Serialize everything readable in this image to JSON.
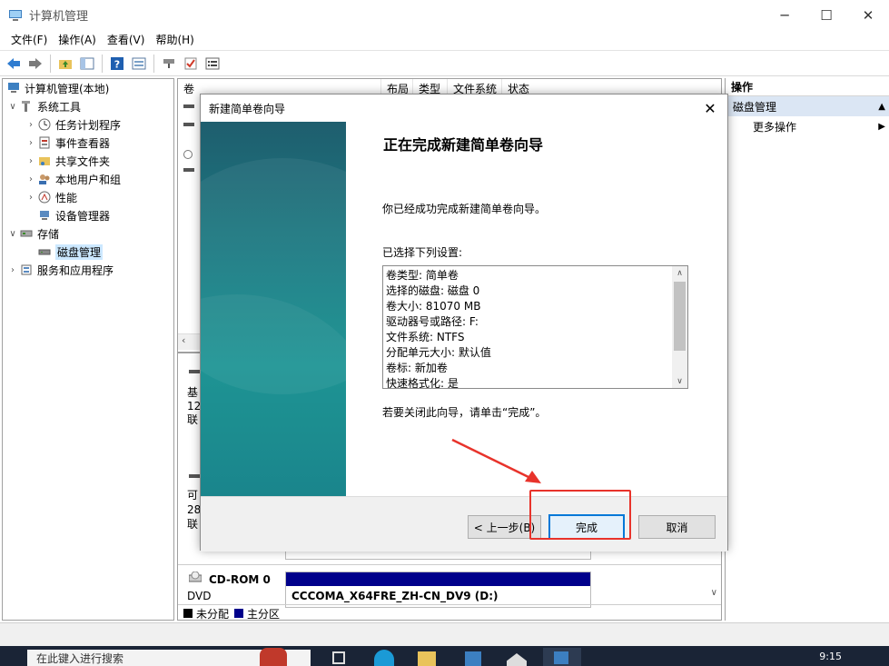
{
  "window": {
    "title": "计算机管理"
  },
  "menu": [
    "文件(F)",
    "操作(A)",
    "查看(V)",
    "帮助(H)"
  ],
  "tree": {
    "root": "计算机管理(本地)",
    "system_tools": "系统工具",
    "task_scheduler": "任务计划程序",
    "event_viewer": "事件查看器",
    "shared_folders": "共享文件夹",
    "local_users": "本地用户和组",
    "performance": "性能",
    "device_manager": "设备管理器",
    "storage": "存储",
    "disk_management": "磁盘管理",
    "services": "服务和应用程序"
  },
  "volume_columns": [
    "卷",
    "布局",
    "类型",
    "文件系统",
    "状态"
  ],
  "disks": {
    "disk0_lines": [
      "基",
      "12",
      "联"
    ],
    "disk1_lines": [
      "可",
      "28",
      "联"
    ],
    "cdrom_name": "CD-ROM 0",
    "cdrom_type": "DVD",
    "cdrom_volume": "CCCOMA_X64FRE_ZH-CN_DV9 (D:)"
  },
  "legend": {
    "unallocated": "未分配",
    "primary": "主分区"
  },
  "actions": {
    "header": "操作",
    "section": "磁盘管理",
    "more": "更多操作"
  },
  "wizard": {
    "title": "新建简单卷向导",
    "heading": "正在完成新建简单卷向导",
    "success": "你已经成功完成新建简单卷向导。",
    "selected_label": "已选择下列设置:",
    "settings": [
      "卷类型: 简单卷",
      "选择的磁盘: 磁盘 0",
      "卷大小: 81070 MB",
      "驱动器号或路径: F:",
      "文件系统: NTFS",
      "分配单元大小: 默认值",
      "卷标: 新加卷",
      "快速格式化: 是"
    ],
    "close_hint": "若要关闭此向导，请单击“完成”。",
    "back_button": "< 上一步(B)",
    "finish_button": "完成",
    "cancel_button": "取消"
  },
  "taskbar": {
    "search_placeholder": "在此键入进行搜索",
    "time": "9:15"
  },
  "colors": {
    "annotation_red": "#e8332b",
    "focus_blue": "#0078d7",
    "primary_partition": "#00008b"
  }
}
